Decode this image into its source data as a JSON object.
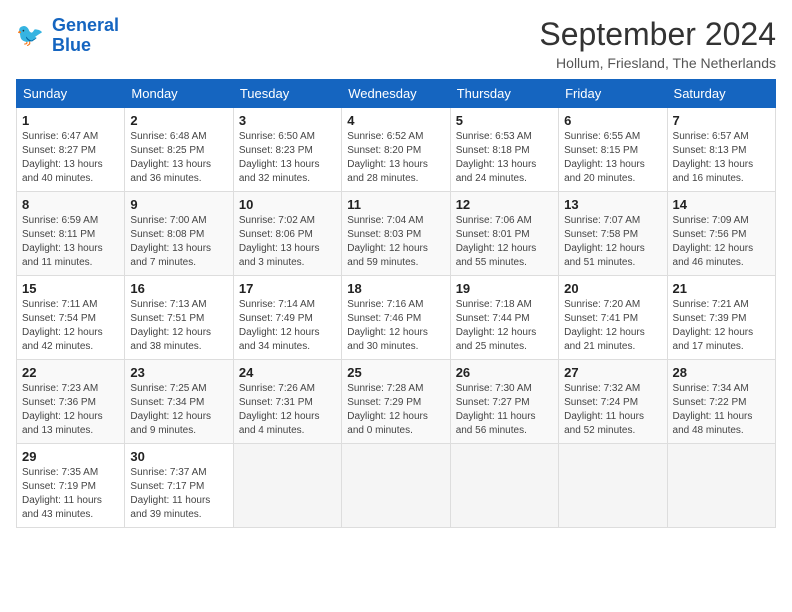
{
  "logo": {
    "line1": "General",
    "line2": "Blue"
  },
  "title": "September 2024",
  "location": "Hollum, Friesland, The Netherlands",
  "headers": [
    "Sunday",
    "Monday",
    "Tuesday",
    "Wednesday",
    "Thursday",
    "Friday",
    "Saturday"
  ],
  "weeks": [
    [
      {
        "day": "1",
        "info": "Sunrise: 6:47 AM\nSunset: 8:27 PM\nDaylight: 13 hours\nand 40 minutes."
      },
      {
        "day": "2",
        "info": "Sunrise: 6:48 AM\nSunset: 8:25 PM\nDaylight: 13 hours\nand 36 minutes."
      },
      {
        "day": "3",
        "info": "Sunrise: 6:50 AM\nSunset: 8:23 PM\nDaylight: 13 hours\nand 32 minutes."
      },
      {
        "day": "4",
        "info": "Sunrise: 6:52 AM\nSunset: 8:20 PM\nDaylight: 13 hours\nand 28 minutes."
      },
      {
        "day": "5",
        "info": "Sunrise: 6:53 AM\nSunset: 8:18 PM\nDaylight: 13 hours\nand 24 minutes."
      },
      {
        "day": "6",
        "info": "Sunrise: 6:55 AM\nSunset: 8:15 PM\nDaylight: 13 hours\nand 20 minutes."
      },
      {
        "day": "7",
        "info": "Sunrise: 6:57 AM\nSunset: 8:13 PM\nDaylight: 13 hours\nand 16 minutes."
      }
    ],
    [
      {
        "day": "8",
        "info": "Sunrise: 6:59 AM\nSunset: 8:11 PM\nDaylight: 13 hours\nand 11 minutes."
      },
      {
        "day": "9",
        "info": "Sunrise: 7:00 AM\nSunset: 8:08 PM\nDaylight: 13 hours\nand 7 minutes."
      },
      {
        "day": "10",
        "info": "Sunrise: 7:02 AM\nSunset: 8:06 PM\nDaylight: 13 hours\nand 3 minutes."
      },
      {
        "day": "11",
        "info": "Sunrise: 7:04 AM\nSunset: 8:03 PM\nDaylight: 12 hours\nand 59 minutes."
      },
      {
        "day": "12",
        "info": "Sunrise: 7:06 AM\nSunset: 8:01 PM\nDaylight: 12 hours\nand 55 minutes."
      },
      {
        "day": "13",
        "info": "Sunrise: 7:07 AM\nSunset: 7:58 PM\nDaylight: 12 hours\nand 51 minutes."
      },
      {
        "day": "14",
        "info": "Sunrise: 7:09 AM\nSunset: 7:56 PM\nDaylight: 12 hours\nand 46 minutes."
      }
    ],
    [
      {
        "day": "15",
        "info": "Sunrise: 7:11 AM\nSunset: 7:54 PM\nDaylight: 12 hours\nand 42 minutes."
      },
      {
        "day": "16",
        "info": "Sunrise: 7:13 AM\nSunset: 7:51 PM\nDaylight: 12 hours\nand 38 minutes."
      },
      {
        "day": "17",
        "info": "Sunrise: 7:14 AM\nSunset: 7:49 PM\nDaylight: 12 hours\nand 34 minutes."
      },
      {
        "day": "18",
        "info": "Sunrise: 7:16 AM\nSunset: 7:46 PM\nDaylight: 12 hours\nand 30 minutes."
      },
      {
        "day": "19",
        "info": "Sunrise: 7:18 AM\nSunset: 7:44 PM\nDaylight: 12 hours\nand 25 minutes."
      },
      {
        "day": "20",
        "info": "Sunrise: 7:20 AM\nSunset: 7:41 PM\nDaylight: 12 hours\nand 21 minutes."
      },
      {
        "day": "21",
        "info": "Sunrise: 7:21 AM\nSunset: 7:39 PM\nDaylight: 12 hours\nand 17 minutes."
      }
    ],
    [
      {
        "day": "22",
        "info": "Sunrise: 7:23 AM\nSunset: 7:36 PM\nDaylight: 12 hours\nand 13 minutes."
      },
      {
        "day": "23",
        "info": "Sunrise: 7:25 AM\nSunset: 7:34 PM\nDaylight: 12 hours\nand 9 minutes."
      },
      {
        "day": "24",
        "info": "Sunrise: 7:26 AM\nSunset: 7:31 PM\nDaylight: 12 hours\nand 4 minutes."
      },
      {
        "day": "25",
        "info": "Sunrise: 7:28 AM\nSunset: 7:29 PM\nDaylight: 12 hours\nand 0 minutes."
      },
      {
        "day": "26",
        "info": "Sunrise: 7:30 AM\nSunset: 7:27 PM\nDaylight: 11 hours\nand 56 minutes."
      },
      {
        "day": "27",
        "info": "Sunrise: 7:32 AM\nSunset: 7:24 PM\nDaylight: 11 hours\nand 52 minutes."
      },
      {
        "day": "28",
        "info": "Sunrise: 7:34 AM\nSunset: 7:22 PM\nDaylight: 11 hours\nand 48 minutes."
      }
    ],
    [
      {
        "day": "29",
        "info": "Sunrise: 7:35 AM\nSunset: 7:19 PM\nDaylight: 11 hours\nand 43 minutes."
      },
      {
        "day": "30",
        "info": "Sunrise: 7:37 AM\nSunset: 7:17 PM\nDaylight: 11 hours\nand 39 minutes."
      },
      {
        "day": "",
        "info": ""
      },
      {
        "day": "",
        "info": ""
      },
      {
        "day": "",
        "info": ""
      },
      {
        "day": "",
        "info": ""
      },
      {
        "day": "",
        "info": ""
      }
    ]
  ]
}
